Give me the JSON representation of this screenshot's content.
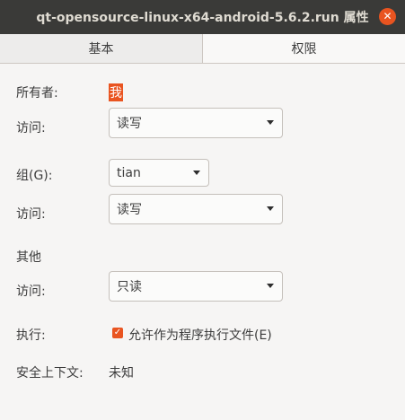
{
  "window": {
    "title": "qt-opensource-linux-x64-android-5.6.2.run 属性",
    "close_glyph": "✕"
  },
  "tabs": [
    {
      "label": "基本"
    },
    {
      "label": "权限"
    }
  ],
  "permissions": {
    "owner": {
      "label": "所有者:",
      "value": "我"
    },
    "owner_access": {
      "label": "访问:",
      "value": "读写"
    },
    "group": {
      "label": "组(G):",
      "value": "tian"
    },
    "group_access": {
      "label": "访问:",
      "value": "读写"
    },
    "others": {
      "heading": "其他"
    },
    "others_access": {
      "label": "访问:",
      "value": "只读"
    },
    "execute": {
      "label": "执行:",
      "checkbox_label": "允许作为程序执行文件(E)",
      "checked": true
    },
    "security_context": {
      "label": "安全上下文:",
      "value": "未知"
    }
  },
  "colors": {
    "accent": "#e95420",
    "titlebar": "#3a3a38"
  }
}
